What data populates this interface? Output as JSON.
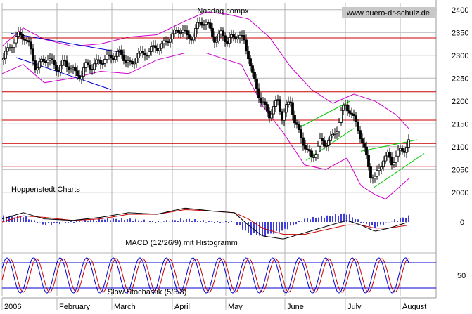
{
  "chart_data": [
    {
      "type": "candlestick",
      "title": "Nasdaq compx",
      "source_label": "www.buero-dr-schulz.de",
      "watermark": "Hoppenstedt Charts",
      "x_labels": [
        "2006",
        "February",
        "March",
        "April",
        "May",
        "June",
        "July",
        "August"
      ],
      "y_ticks": [
        2000,
        2050,
        2100,
        2150,
        2200,
        2250,
        2300,
        2350,
        2400
      ],
      "ylim": [
        1975,
        2415
      ],
      "grid": true,
      "price_points": [
        [
          0,
          2290
        ],
        [
          8,
          2310
        ],
        [
          16,
          2330
        ],
        [
          24,
          2345
        ],
        [
          32,
          2340
        ],
        [
          40,
          2315
        ],
        [
          48,
          2270
        ],
        [
          56,
          2285
        ],
        [
          64,
          2295
        ],
        [
          72,
          2280
        ],
        [
          80,
          2270
        ],
        [
          88,
          2285
        ],
        [
          96,
          2275
        ],
        [
          104,
          2260
        ],
        [
          112,
          2255
        ],
        [
          120,
          2280
        ],
        [
          128,
          2275
        ],
        [
          136,
          2285
        ],
        [
          144,
          2290
        ],
        [
          152,
          2295
        ],
        [
          160,
          2300
        ],
        [
          168,
          2305
        ],
        [
          176,
          2290
        ],
        [
          184,
          2275
        ],
        [
          192,
          2305
        ],
        [
          200,
          2300
        ],
        [
          208,
          2310
        ],
        [
          216,
          2315
        ],
        [
          224,
          2320
        ],
        [
          232,
          2325
        ],
        [
          240,
          2345
        ],
        [
          248,
          2350
        ],
        [
          256,
          2360
        ],
        [
          264,
          2335
        ],
        [
          272,
          2345
        ],
        [
          280,
          2370
        ],
        [
          288,
          2375
        ],
        [
          296,
          2355
        ],
        [
          304,
          2330
        ],
        [
          312,
          2350
        ],
        [
          320,
          2330
        ],
        [
          328,
          2340
        ],
        [
          336,
          2345
        ],
        [
          344,
          2330
        ],
        [
          350,
          2300
        ],
        [
          356,
          2255
        ],
        [
          362,
          2230
        ],
        [
          368,
          2200
        ],
        [
          374,
          2185
        ],
        [
          380,
          2170
        ],
        [
          386,
          2185
        ],
        [
          392,
          2200
        ],
        [
          398,
          2165
        ],
        [
          404,
          2185
        ],
        [
          410,
          2200
        ],
        [
          416,
          2155
        ],
        [
          422,
          2130
        ],
        [
          428,
          2110
        ],
        [
          434,
          2090
        ],
        [
          440,
          2075
        ],
        [
          446,
          2090
        ],
        [
          452,
          2110
        ],
        [
          458,
          2105
        ],
        [
          464,
          2115
        ],
        [
          470,
          2120
        ],
        [
          476,
          2140
        ],
        [
          482,
          2175
        ],
        [
          488,
          2190
        ],
        [
          494,
          2180
        ],
        [
          500,
          2160
        ],
        [
          506,
          2140
        ],
        [
          512,
          2110
        ],
        [
          518,
          2075
        ],
        [
          524,
          2040
        ],
        [
          530,
          2030
        ],
        [
          536,
          2050
        ],
        [
          542,
          2075
        ],
        [
          548,
          2080
        ],
        [
          554,
          2065
        ],
        [
          560,
          2080
        ],
        [
          566,
          2090
        ],
        [
          572,
          2095
        ],
        [
          578,
          2110
        ]
      ],
      "bollinger_upper": [
        [
          0,
          2320
        ],
        [
          30,
          2360
        ],
        [
          60,
          2335
        ],
        [
          100,
          2320
        ],
        [
          140,
          2325
        ],
        [
          180,
          2340
        ],
        [
          220,
          2345
        ],
        [
          260,
          2375
        ],
        [
          290,
          2395
        ],
        [
          320,
          2390
        ],
        [
          350,
          2380
        ],
        [
          380,
          2340
        ],
        [
          410,
          2275
        ],
        [
          440,
          2225
        ],
        [
          470,
          2195
        ],
        [
          500,
          2215
        ],
        [
          530,
          2200
        ],
        [
          560,
          2170
        ],
        [
          578,
          2140
        ]
      ],
      "bollinger_lower": [
        [
          0,
          2260
        ],
        [
          30,
          2280
        ],
        [
          60,
          2240
        ],
        [
          100,
          2250
        ],
        [
          140,
          2265
        ],
        [
          180,
          2260
        ],
        [
          220,
          2290
        ],
        [
          260,
          2305
        ],
        [
          290,
          2305
        ],
        [
          320,
          2290
        ],
        [
          340,
          2280
        ],
        [
          370,
          2190
        ],
        [
          400,
          2130
        ],
        [
          430,
          2060
        ],
        [
          460,
          2050
        ],
        [
          490,
          2075
        ],
        [
          510,
          2015
        ],
        [
          530,
          1995
        ],
        [
          545,
          1985
        ],
        [
          560,
          2005
        ],
        [
          578,
          2030
        ]
      ],
      "horizontal_lines": [
        2338,
        2220,
        2158,
        2107,
        2057
      ],
      "trendlines": [
        {
          "color": "blue",
          "from": [
            13,
            2348
          ],
          "to": [
            175,
            2305
          ]
        },
        {
          "color": "blue",
          "from": [
            20,
            2295
          ],
          "to": [
            155,
            2225
          ]
        },
        {
          "color": "green",
          "from": [
            420,
            2140
          ],
          "to": [
            495,
            2200
          ]
        },
        {
          "color": "green",
          "from": [
            432,
            2070
          ],
          "to": [
            500,
            2140
          ]
        },
        {
          "color": "green",
          "from": [
            510,
            2090
          ],
          "to": [
            590,
            2115
          ]
        },
        {
          "color": "green",
          "from": [
            528,
            2010
          ],
          "to": [
            600,
            2085
          ]
        }
      ]
    },
    {
      "type": "line",
      "title": "MACD (12/26/9) mit Histogramm",
      "y_ticks": [
        0
      ],
      "series": [],
      "macd_line": [
        [
          0,
          0.2
        ],
        [
          30,
          0.6
        ],
        [
          60,
          0.2
        ],
        [
          100,
          0.1
        ],
        [
          140,
          0.3
        ],
        [
          180,
          0.6
        ],
        [
          220,
          0.5
        ],
        [
          260,
          0.9
        ],
        [
          300,
          0.7
        ],
        [
          330,
          0.6
        ],
        [
          350,
          -0.2
        ],
        [
          370,
          -0.9
        ],
        [
          400,
          -1.1
        ],
        [
          430,
          -0.7
        ],
        [
          460,
          -0.3
        ],
        [
          490,
          0.1
        ],
        [
          510,
          -0.2
        ],
        [
          530,
          -0.6
        ],
        [
          550,
          -0.4
        ],
        [
          578,
          0.0
        ]
      ],
      "signal_line": [
        [
          0,
          0.0
        ],
        [
          30,
          0.4
        ],
        [
          60,
          0.3
        ],
        [
          100,
          0.1
        ],
        [
          140,
          0.2
        ],
        [
          180,
          0.5
        ],
        [
          220,
          0.5
        ],
        [
          260,
          0.8
        ],
        [
          300,
          0.7
        ],
        [
          330,
          0.6
        ],
        [
          350,
          0.2
        ],
        [
          370,
          -0.4
        ],
        [
          400,
          -0.8
        ],
        [
          430,
          -0.8
        ],
        [
          460,
          -0.5
        ],
        [
          490,
          -0.2
        ],
        [
          510,
          -0.2
        ],
        [
          530,
          -0.4
        ],
        [
          550,
          -0.4
        ],
        [
          578,
          -0.2
        ]
      ],
      "ylim": [
        -1.4,
        1.4
      ]
    },
    {
      "type": "line",
      "title": "Slow Stochastik (5/3/3)",
      "y_ticks": [
        50
      ],
      "ylim": [
        0,
        100
      ],
      "k_line_period": 37,
      "d_line_lag": 4,
      "upper_band": 80,
      "lower_band": 20
    }
  ],
  "colors": {
    "candle": "#000000",
    "bollinger": "#cc00cc",
    "support_resistance": "#cc0000",
    "trend_blue": "#0000cc",
    "trend_green": "#00cc00",
    "macd_hist": "#0000cc"
  }
}
